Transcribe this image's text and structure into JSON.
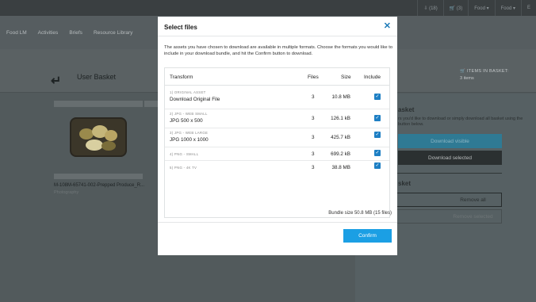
{
  "topbar": {
    "downloads": "⇩ (18)",
    "cart": "🛒 (3)",
    "menu1": "Food ▾",
    "menu2": "Food ▾",
    "extra": "E"
  },
  "nav": {
    "items": [
      "Food LM",
      "Activities",
      "Briefs",
      "Resource Library"
    ]
  },
  "page": {
    "title": "User Basket",
    "items_in_basket_label": "ITEMS IN BASKET:",
    "items_in_basket_value": "3 items"
  },
  "asset": {
    "name": "M-108M-65741-002-Prepped Produce_R...",
    "type": "Photography",
    "name_partial": "M",
    "type_partial": "P"
  },
  "right_panel": {
    "title": "asket",
    "description": "rs you'd like to download or simply download all basket using the button below.",
    "download_visible": "Download visible",
    "download_selected": "Download selected",
    "title2": "sket",
    "remove_all": "Remove all",
    "remove_selected": "Remove selected"
  },
  "modal": {
    "title": "Select files",
    "description": "The assets you have chosen to download are available in multiple formats. Choose the formats you would like to include in your download bundle, and hit the Confirm button to download.",
    "columns": {
      "transform": "Transform",
      "files": "Files",
      "size": "Size",
      "include": "Include"
    },
    "rows": [
      {
        "sub": "1) ORIGINAL ASSET",
        "name": "Download Original File",
        "files": "3",
        "size": "10.8 MB",
        "include": true
      },
      {
        "sub": "2) JPG - WEB SMALL",
        "name": "JPG 500 x 500",
        "files": "3",
        "size": "126.1 kB",
        "include": true
      },
      {
        "sub": "3) JPG - WEB LARGE",
        "name": "JPG 1000 x 1000",
        "files": "3",
        "size": "425.7 kB",
        "include": true
      },
      {
        "sub": "4) PNG - SMALL",
        "name": "",
        "files": "3",
        "size": "699.2 kB",
        "include": true
      },
      {
        "sub": "5) PNG - 4K TV",
        "name": "",
        "files": "3",
        "size": "38.8 MB",
        "include": true
      }
    ],
    "bundle_size": "Bundle size 50.8 MB (15 files)",
    "confirm": "Confirm",
    "close_icon": "close-icon"
  },
  "colors": {
    "accent": "#1b9fe4",
    "checkbox": "#1e7fc4",
    "overlay": "#4f5658"
  }
}
